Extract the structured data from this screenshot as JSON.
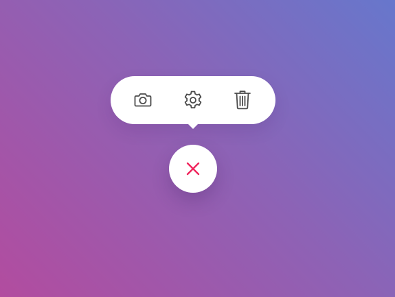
{
  "background": {
    "gradient_colors": [
      "#6777cc",
      "#8c63b6",
      "#b24c9f"
    ]
  },
  "popover_menu": {
    "actions": [
      {
        "icon": "camera-icon",
        "color": "#4a4a4a"
      },
      {
        "icon": "gear-icon",
        "color": "#4a4a4a"
      },
      {
        "icon": "trash-icon",
        "color": "#4a4a4a"
      }
    ],
    "background_color": "#ffffff"
  },
  "close_button": {
    "icon": "close-icon",
    "icon_color": "#f0245c",
    "background_color": "#ffffff"
  }
}
